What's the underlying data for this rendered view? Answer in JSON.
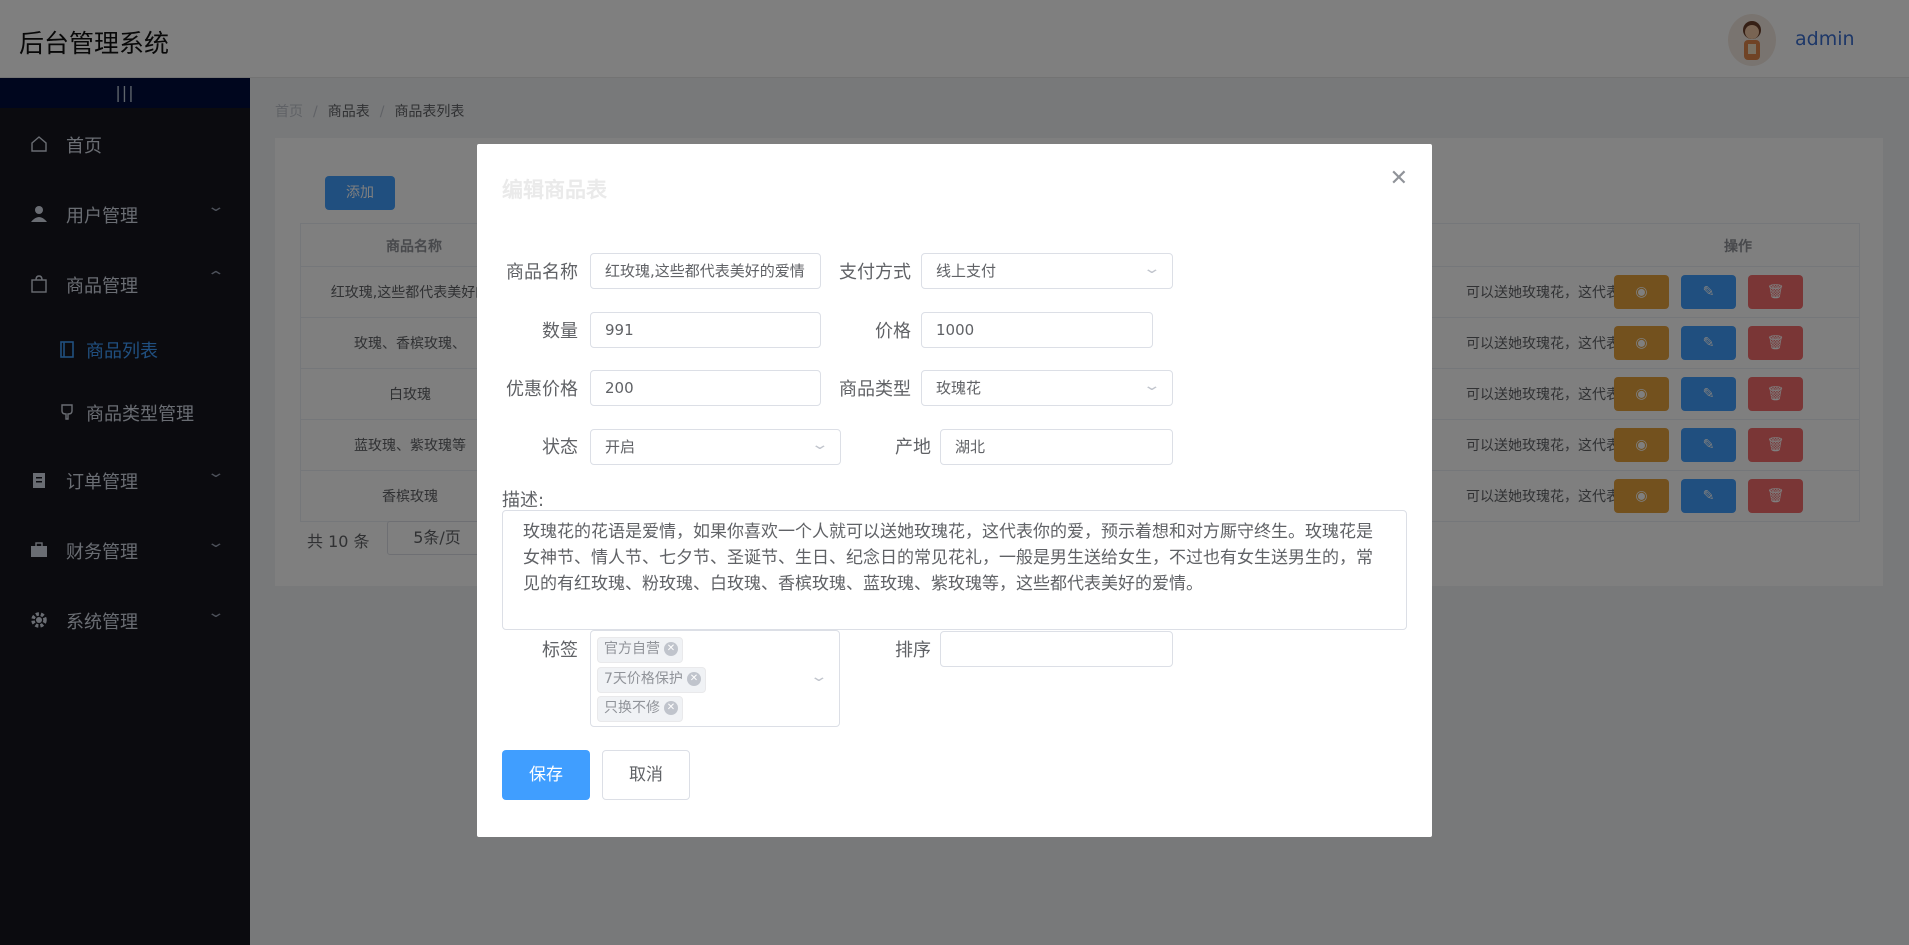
{
  "header": {
    "title": "后台管理系统",
    "username": "admin"
  },
  "sidebar": {
    "toggle": "|||",
    "items": [
      {
        "label": "首页"
      },
      {
        "label": "用户管理"
      },
      {
        "label": "商品管理"
      },
      {
        "label": "商品列表"
      },
      {
        "label": "商品类型管理"
      },
      {
        "label": "订单管理"
      },
      {
        "label": "财务管理"
      },
      {
        "label": "系统管理"
      }
    ]
  },
  "breadcrumb": [
    "首页",
    "商品表",
    "商品表列表"
  ],
  "list": {
    "add_label": "添加",
    "columns": {
      "name": "商品名称",
      "ops": "操作"
    },
    "rows": [
      {
        "name": "红玫瑰,这些都代表美好的",
        "desc": "可以送她玫瑰花，这代表..."
      },
      {
        "name": "玫瑰、香槟玫瑰、",
        "desc": "可以送她玫瑰花，这代表..."
      },
      {
        "name": "白玫瑰",
        "desc": "可以送她玫瑰花，这代表..."
      },
      {
        "name": "蓝玫瑰、紫玫瑰等",
        "desc": "可以送她玫瑰花，这代表..."
      },
      {
        "name": "香槟玫瑰",
        "desc": "可以送她玫瑰花，这代表..."
      }
    ],
    "total": "共 10 条",
    "page_size": "5条/页"
  },
  "dialog": {
    "title": "编辑商品表",
    "fields": {
      "name": {
        "label": "商品名称",
        "value": "红玫瑰,这些都代表美好的爱情"
      },
      "pay": {
        "label": "支付方式",
        "value": "线上支付"
      },
      "qty": {
        "label": "数量",
        "value": "991"
      },
      "price": {
        "label": "价格",
        "value": "1000"
      },
      "discount": {
        "label": "优惠价格",
        "value": "200"
      },
      "type": {
        "label": "商品类型",
        "value": "玫瑰花"
      },
      "status": {
        "label": "状态",
        "value": "开启"
      },
      "origin": {
        "label": "产地",
        "value": "湖北"
      },
      "desc": {
        "label": "描述:",
        "value": "玫瑰花的花语是爱情，如果你喜欢一个人就可以送她玫瑰花，这代表你的爱，预示着想和对方厮守终生。玫瑰花是女神节、情人节、七夕节、圣诞节、生日、纪念日的常见花礼，一般是男生送给女生，不过也有女生送男生的，常见的有红玫瑰、粉玫瑰、白玫瑰、香槟玫瑰、蓝玫瑰、紫玫瑰等，这些都代表美好的爱情。"
      },
      "tags": {
        "label": "标签",
        "items": [
          "官方自营",
          "7天价格保护",
          "只换不修"
        ]
      },
      "sort": {
        "label": "排序",
        "value": ""
      }
    },
    "save_label": "保存",
    "cancel_label": "取消"
  },
  "colors": {
    "primary": "#409eff",
    "warning": "#e6a23c",
    "danger": "#f56c6c",
    "sidebar": "#16171f"
  }
}
